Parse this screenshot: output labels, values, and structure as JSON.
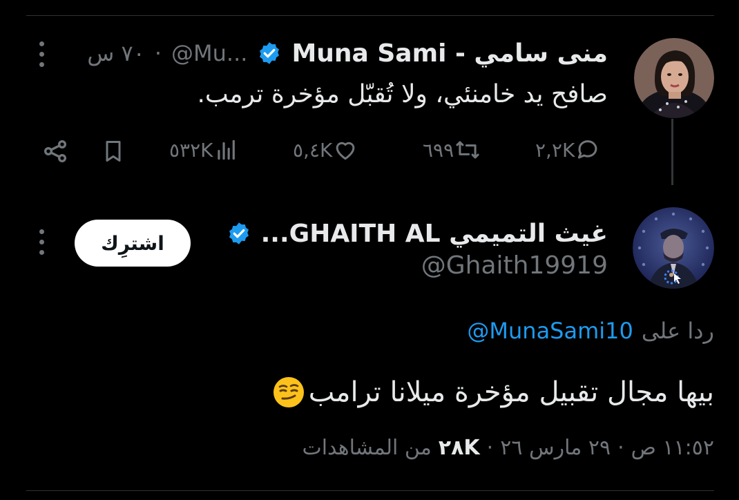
{
  "colors": {
    "background": "#000000",
    "text": "#e7e9ea",
    "muted": "#71767b",
    "accent": "#1d9bf0",
    "verified": "#1d9bf0"
  },
  "original_post": {
    "display_name": "منى سامي - Muna Sami",
    "verified_icon": "verified-badge-icon",
    "handle": "@Mu...",
    "time": "٧٠ س",
    "separator": "·",
    "text": "صافح يد خامنئي، ولا تُقبّل مؤخرة ترمب.",
    "actions": {
      "replies": "٢,٢K",
      "reposts": "٦٩٩",
      "likes": "٥,٤K",
      "views": "٥٣٢K"
    }
  },
  "reply_post": {
    "display_name": "غيث التميمي GHAITH AL...",
    "handle": "@Ghaith19919",
    "subscribe_label": "اشترِك",
    "replying_to_prefix": "ردا على",
    "replying_to_handle": "@MunaSami10",
    "text": "بيها مجال تقبيل مؤخرة ميلانا ترامب",
    "emoji": "smirking-face",
    "meta": {
      "time": "١١:٥٢ ص",
      "date": "٢٩ مارس ٢٦",
      "views_count": "٢٨K",
      "views_label": "من المشاهدات",
      "separator": "·"
    }
  }
}
